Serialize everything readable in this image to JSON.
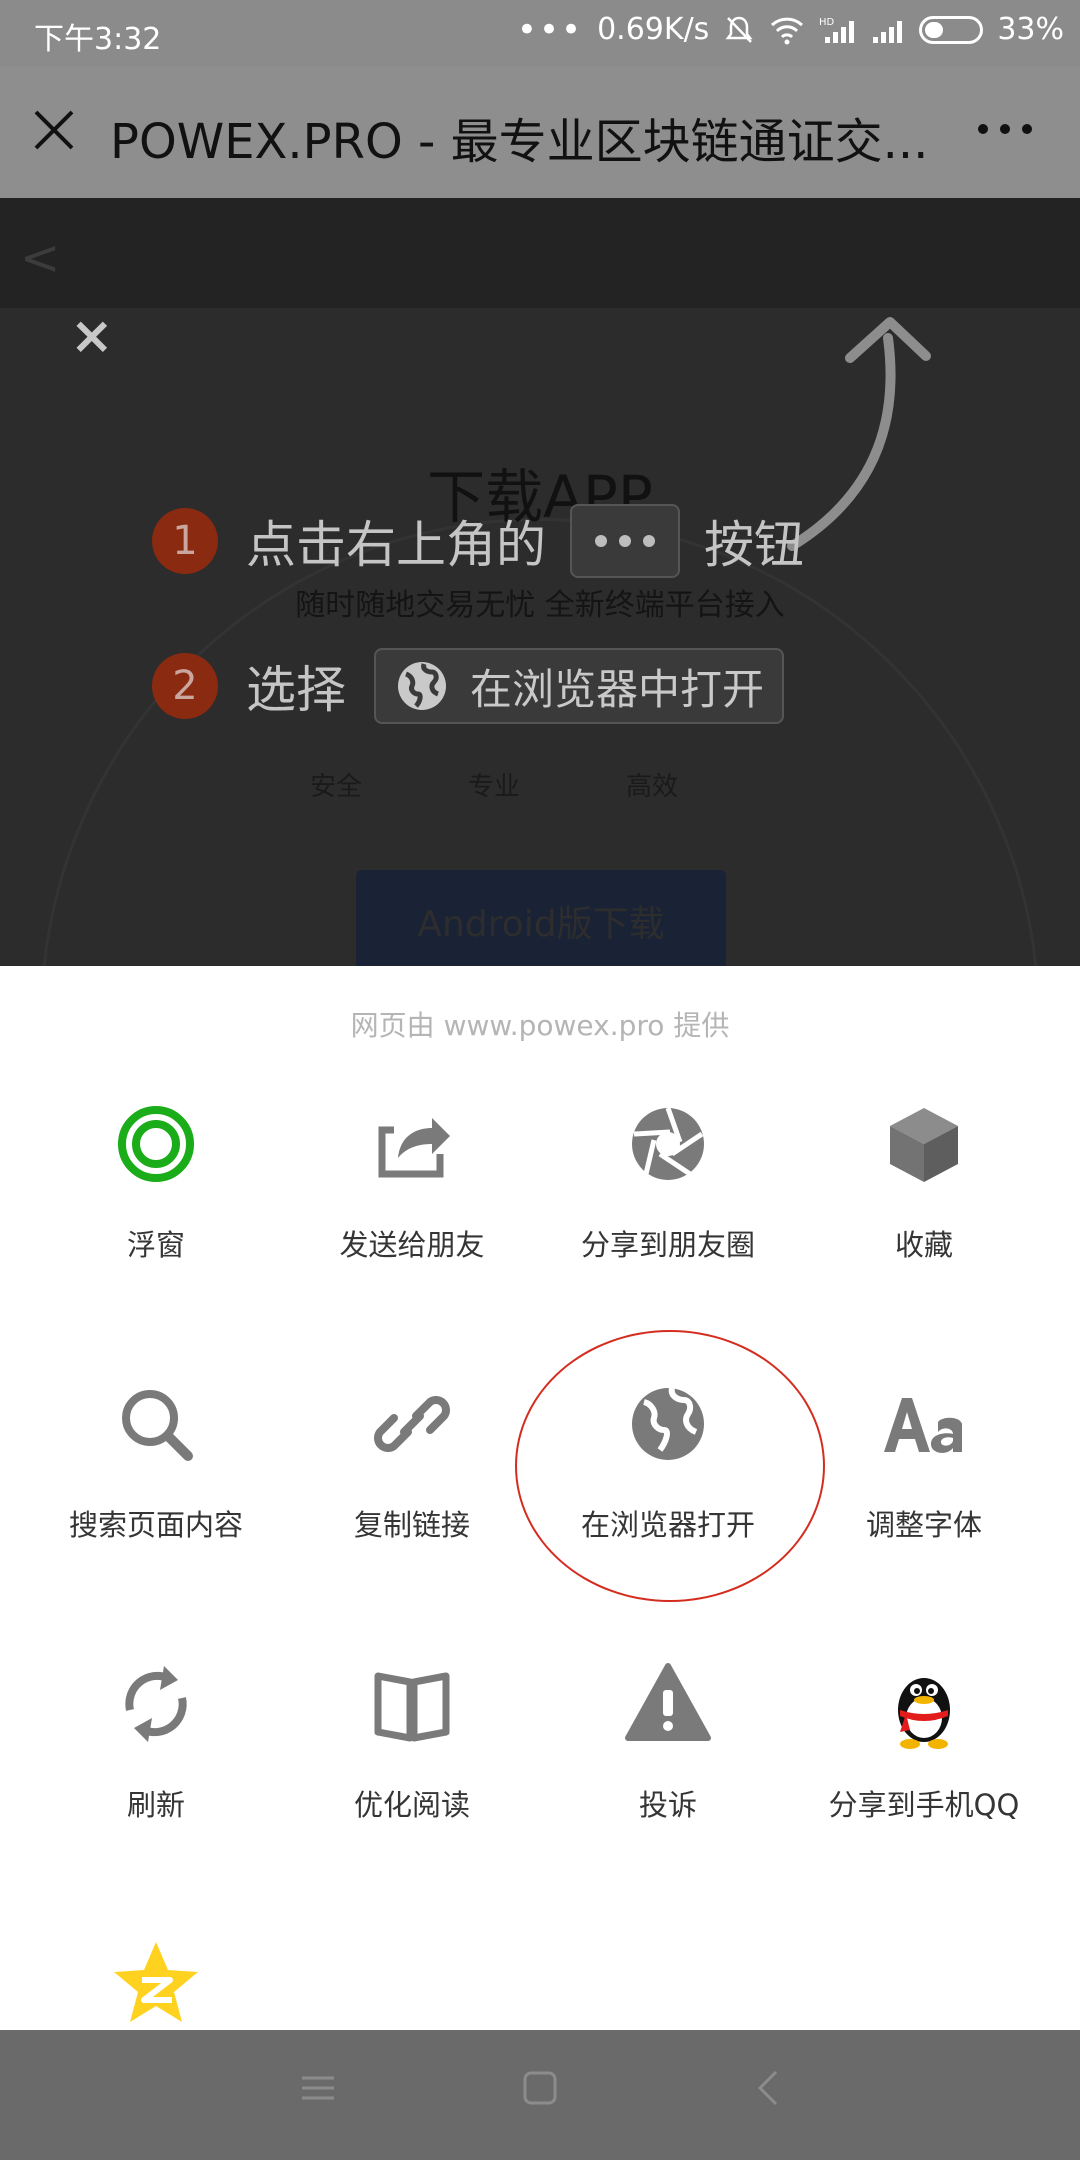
{
  "status_bar": {
    "time": "下午3:32",
    "network_speed": "0.69K/s",
    "battery": "33%"
  },
  "title_bar": {
    "title": "POWEX.PRO - 最专业区块链通证交..."
  },
  "background_page": {
    "heading": "下载APP",
    "subheading": "随时随地交易无忧 全新终端平台接入",
    "features": [
      "安全",
      "专业",
      "高效"
    ],
    "android_button": "Android版下载"
  },
  "guide": {
    "step1_number": "1",
    "step1_text": "点击右上角的",
    "step1_suffix": "按钮",
    "step2_number": "2",
    "step2_text": "选择",
    "step2_button": "在浏览器中打开"
  },
  "sheet": {
    "provider": "网页由 www.powex.pro 提供",
    "items": [
      {
        "label": "浮窗",
        "icon": "floating-window-icon"
      },
      {
        "label": "发送给朋友",
        "icon": "share-arrow-icon"
      },
      {
        "label": "分享到朋友圈",
        "icon": "moments-shutter-icon"
      },
      {
        "label": "收藏",
        "icon": "cube-icon"
      },
      {
        "label": "搜索页面内容",
        "icon": "search-icon"
      },
      {
        "label": "复制链接",
        "icon": "link-icon"
      },
      {
        "label": "在浏览器打开",
        "icon": "globe-icon"
      },
      {
        "label": "调整字体",
        "icon": "font-aa-icon"
      },
      {
        "label": "刷新",
        "icon": "refresh-icon"
      },
      {
        "label": "优化阅读",
        "icon": "book-icon"
      },
      {
        "label": "投诉",
        "icon": "warning-icon"
      },
      {
        "label": "分享到手机QQ",
        "icon": "qq-penguin-icon"
      },
      {
        "label": "",
        "icon": "qzone-star-icon"
      }
    ]
  },
  "colors": {
    "accent_green": "#1aad19",
    "icon_gray": "#7a7a7a",
    "highlight_red": "#d42d1f"
  }
}
